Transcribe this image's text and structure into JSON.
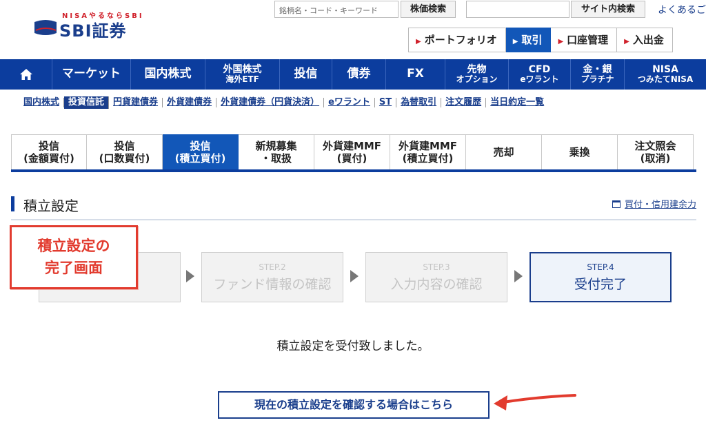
{
  "header": {
    "logo_tagline": "NISAやるならSBI",
    "logo_mark": "SBI",
    "logo_name": "SBI証券",
    "stock_search": {
      "placeholder": "銘柄名・コード・キーワード",
      "button_label": "株価検索"
    },
    "site_search": {
      "button_label": "サイト内検索"
    },
    "faq_label": "よくあるご",
    "quick_nav": [
      {
        "label": "ポートフォリオ",
        "active": false
      },
      {
        "label": "取引",
        "active": true
      },
      {
        "label": "口座管理",
        "active": false
      },
      {
        "label": "入出金",
        "active": false
      }
    ]
  },
  "global_nav": {
    "home_icon": "home-icon",
    "items": [
      {
        "line1": "マーケット"
      },
      {
        "line1": "国内株式"
      },
      {
        "line1": "外国株式",
        "line2": "海外ETF"
      },
      {
        "line1": "投信"
      },
      {
        "line1": "債券"
      },
      {
        "line1": "FX"
      },
      {
        "line1": "先物",
        "line2": "オプション"
      },
      {
        "line1": "CFD",
        "line2": "eワラント"
      },
      {
        "line1": "金・銀",
        "line2": "プラチナ"
      },
      {
        "line1": "NISA",
        "line2": "つみたてNISA"
      }
    ]
  },
  "sub_nav": {
    "items": [
      {
        "label": "国内株式",
        "active": false
      },
      {
        "label": "投資信託",
        "active": true
      },
      {
        "label": "円貨建債券",
        "active": false
      },
      {
        "label": "外貨建債券",
        "active": false
      },
      {
        "label": "外貨建債券（円貨決済）",
        "active": false
      },
      {
        "label": "eワラント",
        "active": false
      },
      {
        "label": "ST",
        "active": false
      },
      {
        "label": "為替取引",
        "active": false
      },
      {
        "label": "注文履歴",
        "active": false
      },
      {
        "label": "当日約定一覧",
        "active": false
      }
    ]
  },
  "tabs": [
    {
      "line1": "投信",
      "line2": "(金額買付)",
      "active": false
    },
    {
      "line1": "投信",
      "line2": "(口数買付)",
      "active": false
    },
    {
      "line1": "投信",
      "line2": "(積立買付)",
      "active": true
    },
    {
      "line1": "新規募集",
      "line2": "・取扱",
      "active": false
    },
    {
      "line1": "外貨建MMF",
      "line2": "(買付)",
      "active": false
    },
    {
      "line1": "外貨建MMF",
      "line2": "(積立買付)",
      "active": false
    },
    {
      "line1": "売却",
      "line2": "",
      "active": false
    },
    {
      "line1": "乗換",
      "line2": "",
      "active": false
    },
    {
      "line1": "注文照会",
      "line2": "(取消)",
      "active": false
    }
  ],
  "page": {
    "title": "積立設定",
    "buying_power_link": "買付・信用建余力",
    "callout_line1": "積立設定の",
    "callout_line2": "完了画面",
    "steps": [
      {
        "num": "",
        "label": "",
        "active": false
      },
      {
        "num": "STEP.2",
        "label": "ファンド情報の確認",
        "active": false
      },
      {
        "num": "STEP.3",
        "label": "入力内容の確認",
        "active": false
      },
      {
        "num": "STEP.4",
        "label": "受付完了",
        "active": true
      }
    ],
    "done_message": "積立設定を受付致しました。",
    "confirm_button": "現在の積立設定を確認する場合はこちら"
  },
  "colors": {
    "nav_blue": "#0c3d9e",
    "active_blue": "#1257b8",
    "link_blue": "#1a3e8c",
    "annotation_red": "#e23b2e",
    "brand_red": "#d0212b"
  }
}
